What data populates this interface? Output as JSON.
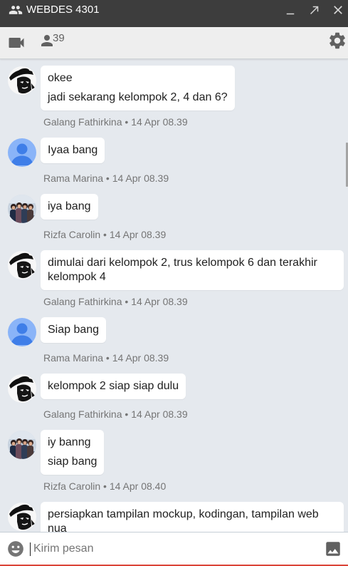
{
  "window": {
    "title": "WEBDES 4301",
    "icons": [
      "group-icon",
      "minimize-icon",
      "expand-icon",
      "close-icon"
    ]
  },
  "toolbar": {
    "participant_count": "39",
    "icons": [
      "video-call-icon",
      "participants-icon",
      "settings-icon"
    ]
  },
  "meta_separator": "•",
  "messages": [
    {
      "sender": "Galang Fathirkina",
      "avatar": "galang-avatar",
      "lines": [
        "okee",
        "jadi sekarang kelompok 2, 4 dan 6?"
      ],
      "time": "14 Apr 08.39"
    },
    {
      "sender": "Rama Marina",
      "avatar": "default-person-avatar",
      "lines": [
        "Iyaa bang"
      ],
      "time": "14 Apr 08.39"
    },
    {
      "sender": "Rizfa Carolin",
      "avatar": "rizfa-avatar",
      "lines": [
        "iya bang"
      ],
      "time": "14 Apr 08.39"
    },
    {
      "sender": "Galang Fathirkina",
      "avatar": "galang-avatar",
      "lines": [
        "dimulai dari kelompok 2, trus kelompok 6 dan terakhir kelompok 4"
      ],
      "time": "14 Apr 08.39"
    },
    {
      "sender": "Rama Marina",
      "avatar": "default-person-avatar",
      "lines": [
        "Siap bang"
      ],
      "time": "14 Apr 08.39"
    },
    {
      "sender": "Galang Fathirkina",
      "avatar": "galang-avatar",
      "lines": [
        "kelompok 2 siap siap dulu"
      ],
      "time": "14 Apr 08.39"
    },
    {
      "sender": "Rizfa Carolin",
      "avatar": "rizfa-avatar",
      "lines": [
        "iy banng",
        "siap bang"
      ],
      "time": "14 Apr 08.40"
    },
    {
      "avatar": "galang-avatar",
      "lines": [
        "persiapkan tampilan mockup, kodingan, tampilan web nua"
      ]
    }
  ],
  "composer": {
    "placeholder": "Kirim pesan",
    "icons": [
      "emoji-icon",
      "image-icon"
    ]
  },
  "colors": {
    "titlebar_bg": "#3d3d3d",
    "toolbar_bg": "#eeeeee",
    "chat_bg": "#e5e9ee",
    "bubble_bg": "#ffffff",
    "message_text": "#212121",
    "meta_text": "#757575",
    "icon_gray": "#616161",
    "composer_accent": "#db4437"
  }
}
